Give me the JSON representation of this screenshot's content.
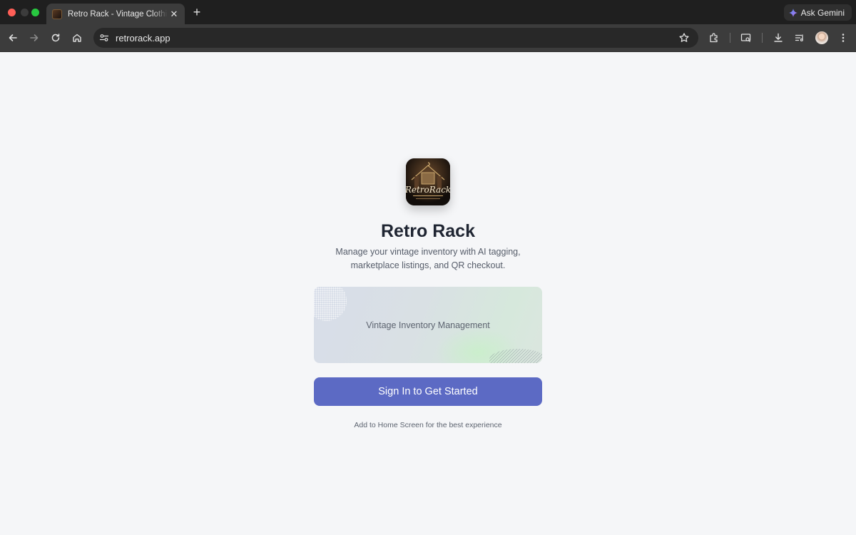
{
  "browser": {
    "tab": {
      "title": "Retro Rack - Vintage Clothing Inventory",
      "close_glyph": "✕"
    },
    "new_tab_glyph": "+",
    "omnibox": {
      "url": "retrorack.app"
    },
    "gemini_label": "Ask Gemini",
    "icons": [
      "back-icon",
      "forward-icon",
      "reload-icon",
      "home-icon",
      "site-info-icon",
      "bookmark-star-icon",
      "extensions-icon",
      "tab-search-icon",
      "downloads-icon",
      "reading-list-icon",
      "profile-avatar",
      "menu-icon"
    ]
  },
  "app": {
    "title": "Retro Rack",
    "description": "Manage your vintage inventory with AI tagging, marketplace listings, and QR checkout.",
    "logo_text": "RetroRack",
    "hero_label": "Vintage Inventory Management",
    "cta_label": "Sign In to Get Started",
    "hint": "Add to Home Screen for the best experience",
    "accent_color": "#5c6ac4"
  }
}
